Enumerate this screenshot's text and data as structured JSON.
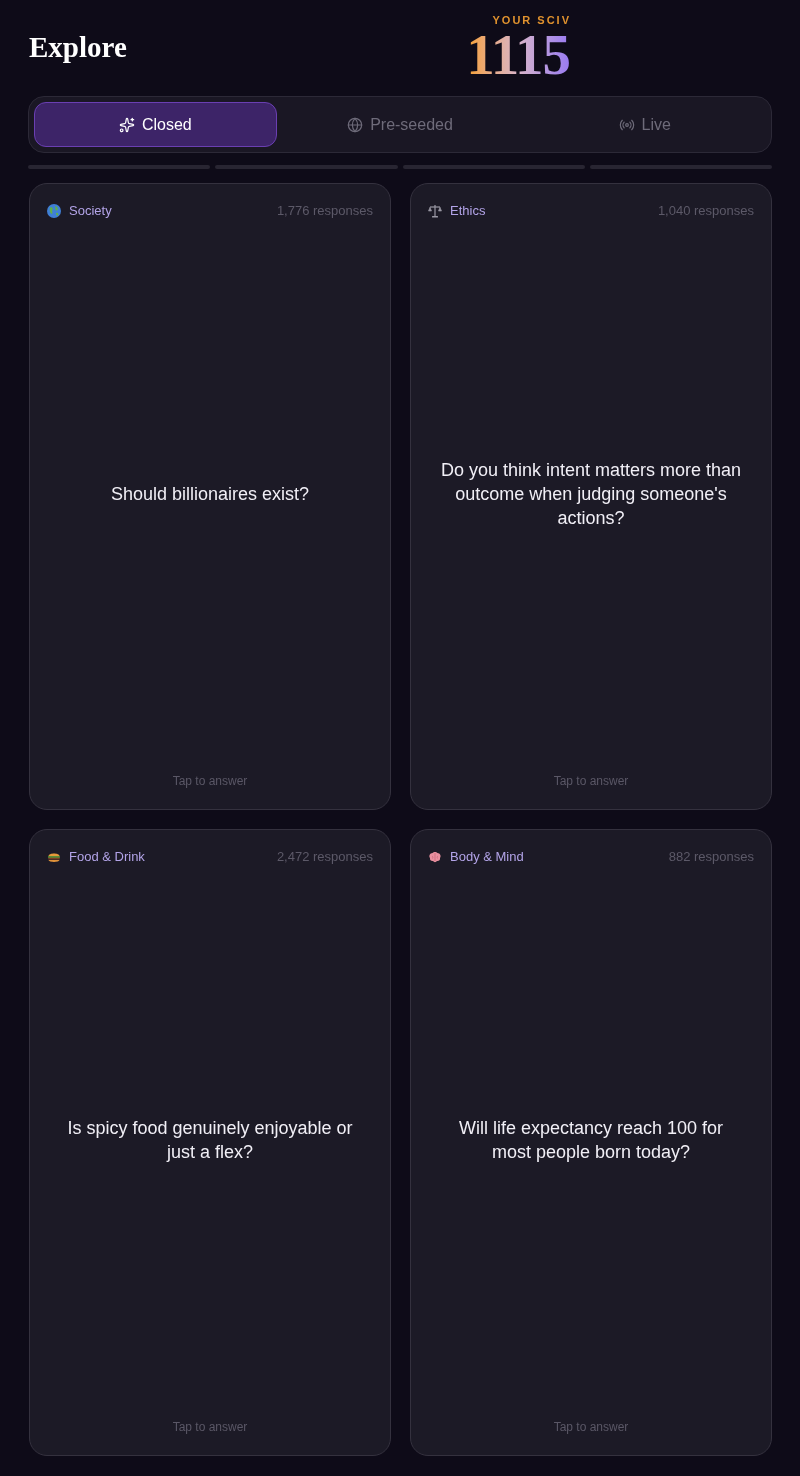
{
  "header": {
    "title": "Explore",
    "score_label": "YOUR SCIV",
    "score": "1115"
  },
  "tabs": [
    {
      "label": "Closed",
      "selected": true
    },
    {
      "label": "Pre-seeded",
      "selected": false
    },
    {
      "label": "Live",
      "selected": false
    }
  ],
  "progress": [
    {
      "level": 0
    },
    {
      "level": 0
    },
    {
      "level": 0
    },
    {
      "level": 0
    }
  ],
  "cards": [
    {
      "category": "Society",
      "responses": "1,776 responses",
      "question": "Should billionaires exist?",
      "hint": "Tap to answer"
    },
    {
      "category": "Ethics",
      "responses": "1,040 responses",
      "question": "Do you think intent matters more than outcome when judging someone's actions?",
      "hint": "Tap to answer"
    },
    {
      "category": "Food & Drink",
      "responses": "2,472 responses",
      "question": "Is spicy food genuinely enjoyable or just a flex?",
      "hint": "Tap to answer"
    },
    {
      "category": "Body & Mind",
      "responses": "882 responses",
      "question": "Will life expectancy reach 100 for most people born today?",
      "hint": "Tap to answer"
    }
  ]
}
